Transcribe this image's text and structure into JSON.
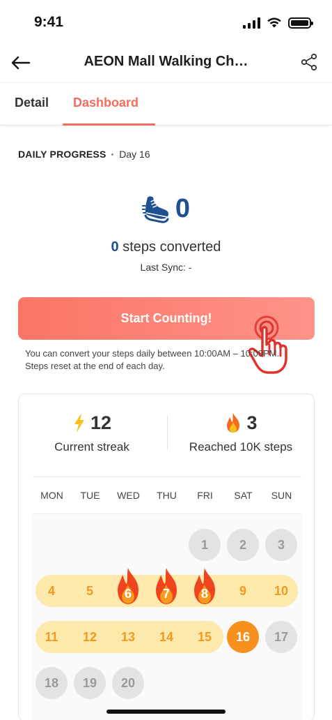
{
  "status_bar": {
    "time": "9:41"
  },
  "header": {
    "title": "AEON Mall Walking Ch…"
  },
  "tabs": [
    {
      "label": "Detail",
      "active": false
    },
    {
      "label": "Dashboard",
      "active": true
    }
  ],
  "daily_progress": {
    "label": "DAILY PROGRESS",
    "separator": "·",
    "day": "Day 16",
    "step_count": "0",
    "converted_number": "0",
    "converted_text": "steps converted",
    "last_sync": "Last Sync: -",
    "start_button": "Start Counting!",
    "note": "You can convert your steps daily between 10:00AM – 10:00PM. Steps reset at the end of each day."
  },
  "stats": {
    "streak_value": "12",
    "streak_label": "Current streak",
    "reached_value": "3",
    "reached_label": "Reached 10K steps"
  },
  "calendar": {
    "day_names": [
      "MON",
      "TUE",
      "WED",
      "THU",
      "FRI",
      "SAT",
      "SUN"
    ],
    "week1": [
      "1",
      "2",
      "3"
    ],
    "week2": [
      "4",
      "5",
      "6",
      "7",
      "8",
      "9",
      "10"
    ],
    "week3": [
      "11",
      "12",
      "13",
      "14",
      "15",
      "16",
      "17"
    ],
    "week4": [
      "18",
      "19",
      "20"
    ]
  },
  "colors": {
    "accent": "#f26d5e",
    "step_blue": "#1d4f91",
    "streak_orange": "#f39a1e",
    "today_orange": "#f7901e",
    "streak_band": "#fde9ab"
  }
}
